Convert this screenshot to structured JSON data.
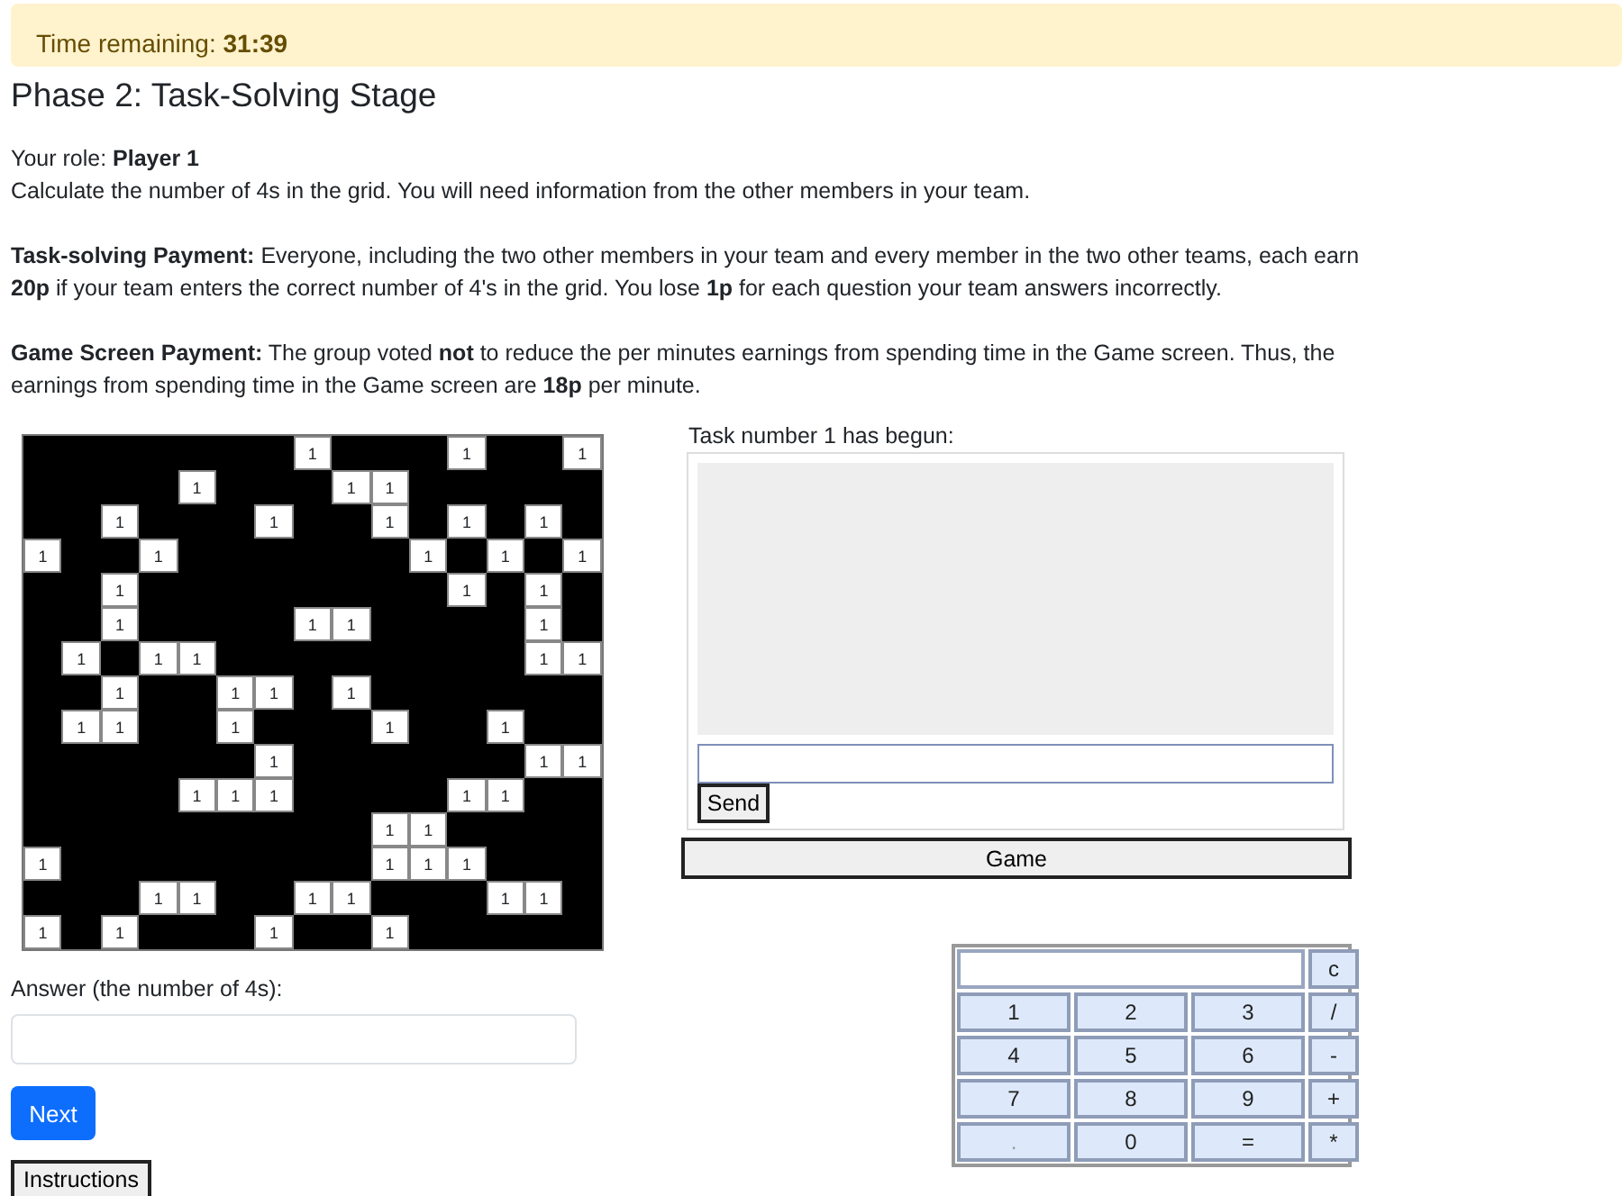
{
  "timer": {
    "label": "Time remaining:",
    "value": "31:39"
  },
  "title": "Phase 2: Task-Solving Stage",
  "role": {
    "label": "Your role:",
    "value": "Player 1"
  },
  "paragraphs": [
    "Calculate the number of 4s in the grid. You will need information from the other members in your team.",
    "**Task-solving Payment:** Everyone, including the two other members in your team and every member in the two other teams, each earn **20p** if your team enters the correct number of 4's in the grid. You lose **1p** for each question your team answers incorrectly.",
    "**Game Screen Payment:** The group voted **not** to reduce the per minutes earnings from spending time in the Game screen. Thus, the earnings from spending time in the Game screen are **18p** per minute."
  ],
  "grid": {
    "rows": [
      [
        null,
        null,
        null,
        null,
        null,
        null,
        null,
        "1",
        null,
        null,
        null,
        "1",
        null,
        null,
        "1"
      ],
      [
        null,
        null,
        null,
        null,
        "1",
        null,
        null,
        null,
        "1",
        "1",
        null,
        null,
        null,
        null,
        null
      ],
      [
        null,
        null,
        "1",
        null,
        null,
        null,
        "1",
        null,
        null,
        "1",
        null,
        "1",
        null,
        "1",
        null
      ],
      [
        "1",
        null,
        null,
        "1",
        null,
        null,
        null,
        null,
        null,
        null,
        "1",
        null,
        "1",
        null,
        "1"
      ],
      [
        null,
        null,
        "1",
        null,
        null,
        null,
        null,
        null,
        null,
        null,
        null,
        "1",
        null,
        "1",
        null
      ],
      [
        null,
        null,
        "1",
        null,
        null,
        null,
        null,
        "1",
        "1",
        null,
        null,
        null,
        null,
        "1",
        null
      ],
      [
        null,
        "1",
        null,
        "1",
        "1",
        null,
        null,
        null,
        null,
        null,
        null,
        null,
        null,
        "1",
        "1"
      ],
      [
        null,
        null,
        "1",
        null,
        null,
        "1",
        "1",
        null,
        "1",
        null,
        null,
        null,
        null,
        null,
        null
      ],
      [
        null,
        "1",
        "1",
        null,
        null,
        "1",
        null,
        null,
        null,
        "1",
        null,
        null,
        "1",
        null,
        null
      ],
      [
        null,
        null,
        null,
        null,
        null,
        null,
        "1",
        null,
        null,
        null,
        null,
        null,
        null,
        "1",
        "1"
      ],
      [
        null,
        null,
        null,
        null,
        "1",
        "1",
        "1",
        null,
        null,
        null,
        null,
        "1",
        "1",
        null,
        null
      ],
      [
        null,
        null,
        null,
        null,
        null,
        null,
        null,
        null,
        null,
        "1",
        "1",
        null,
        null,
        null,
        null
      ],
      [
        "1",
        null,
        null,
        null,
        null,
        null,
        null,
        null,
        null,
        "1",
        "1",
        "1",
        null,
        null,
        null
      ],
      [
        null,
        null,
        null,
        "1",
        "1",
        null,
        null,
        "1",
        "1",
        null,
        null,
        null,
        "1",
        "1",
        null
      ],
      [
        "1",
        null,
        "1",
        null,
        null,
        null,
        "1",
        null,
        null,
        "1",
        null,
        null,
        null,
        null,
        null
      ]
    ]
  },
  "answer": {
    "label": "Answer (the number of 4s):"
  },
  "buttons": {
    "next": "Next",
    "instructions": "Instructions"
  },
  "chat": {
    "label": "Task number 1 has begun:",
    "send": "Send"
  },
  "game_button": "Game",
  "calculator": {
    "clear": "c",
    "rows": [
      [
        "1",
        "2",
        "3",
        "/"
      ],
      [
        "4",
        "5",
        "6",
        "-"
      ],
      [
        "7",
        "8",
        "9",
        "+"
      ],
      [
        ".",
        "0",
        "=",
        "*"
      ]
    ]
  }
}
